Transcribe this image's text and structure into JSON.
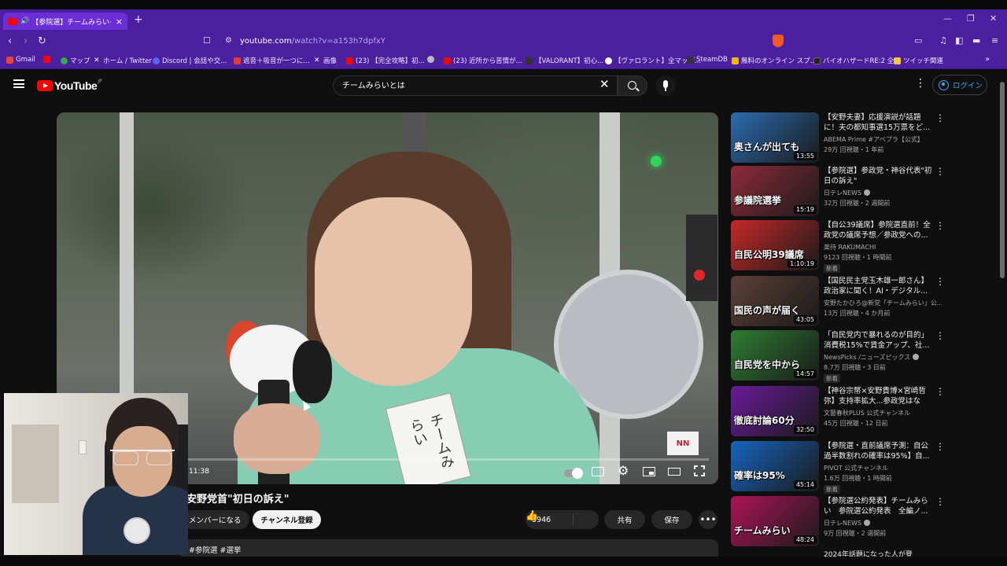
{
  "browser": {
    "tab_title": "【参院選】チームみらい· 安野党首",
    "new_tab": "+",
    "window_minimize": "—",
    "window_restore": "❐",
    "window_close": "✕",
    "url_host": "youtube.com",
    "url_path": "/watch?v=a153h7dpfxY",
    "brave_count": "99+"
  },
  "bookmarks": [
    {
      "label": "Gmail",
      "color": "#ea4335"
    },
    {
      "label": "",
      "color": "#ff0000"
    },
    {
      "label": "マップ",
      "color": "#34a853"
    },
    {
      "label": "ホーム / Twitter",
      "color": "#ffffff"
    },
    {
      "label": "Discord | 会話や交...",
      "color": "#5865f2"
    },
    {
      "label": "遮音＋吸音が一つに...",
      "color": "#e53935"
    },
    {
      "label": "画像",
      "color": "#ffffff"
    },
    {
      "label": "(23) 【完全攻略】初...",
      "color": "#ff0000"
    },
    {
      "label": "",
      "color": "#bbbbbb"
    },
    {
      "label": "(23) 近所から苦情が...",
      "color": "#ff0000"
    },
    {
      "label": "【VALORANT】初心...",
      "color": "#333333"
    },
    {
      "label": "【ヴァロラント】全マップ...",
      "color": "#ffffff"
    },
    {
      "label": "SteamDB",
      "color": "#333333"
    },
    {
      "label": "無料のオンライン スプ...",
      "color": "#f4b400"
    },
    {
      "label": "バイオハザードRE:2 全...",
      "color": "#222222"
    },
    {
      "label": "ツイッチ関連",
      "color": "#f4c542"
    }
  ],
  "youtube": {
    "logo_word": "YouTube",
    "region": "JP",
    "search_value": "チームみらいとは",
    "login_label": "ログイン"
  },
  "player": {
    "time": "11:38",
    "progress": 0.18,
    "name_tag": "チームみらい",
    "news_logo": "NN"
  },
  "video": {
    "title": "安野党首\"初日の訴え\"",
    "member_label": "メンバーになる",
    "subscribe_label": "チャンネル登録",
    "likes": "3946",
    "share_label": "共有",
    "save_label": "保存",
    "more": "•••",
    "hashtags": "#参院選 #選挙"
  },
  "recommendations": [
    {
      "title": "【安野夫妻】応援演説が話題に！夫の都知事選15万票をど...",
      "channel": "ABEMA Prime #アベプラ【公式】",
      "meta": "29万 回視聴・1 年前",
      "duration": "13:55",
      "thumb_text": "奥さんが出ても",
      "bg": "#2b6cb0",
      "verified": false,
      "is_new": false
    },
    {
      "title": "【参院選】参政党・神谷代表\"初日の訴え\"",
      "channel": "日テレNEWS",
      "meta": "32万 回視聴・2 週間前",
      "duration": "15:19",
      "thumb_text": "参議院選挙",
      "bg": "#8e2b3a",
      "verified": true,
      "is_new": false
    },
    {
      "title": "【自公39議席】参院選直前！全政党の議席予想／参政党への...",
      "channel": "楽待 RAKUMACHI",
      "meta": "9123 回視聴・1 時間前",
      "duration": "1:10:19",
      "thumb_text": "自民公明39議席",
      "bg": "#c62828",
      "verified": false,
      "is_new": true
    },
    {
      "title": "【国民民主党玉木雄一郎さん】政治家に聞く！AI・デジタル...",
      "channel": "安野たかひろ@新党「チームみらい」公...",
      "meta": "13万 回視聴・4 か月前",
      "duration": "43:05",
      "thumb_text": "国民の声が届く",
      "bg": "#5d4037",
      "verified": false,
      "is_new": false
    },
    {
      "title": "「自民党内で暴れるのが目的」消費税15%で賃金アップ、社...",
      "channel": "NewsPicks /ニューズピックス",
      "meta": "8.7万 回視聴・3 日前",
      "duration": "14:57",
      "thumb_text": "自民党を中から",
      "bg": "#2e7d32",
      "verified": true,
      "is_new": true
    },
    {
      "title": "【神谷宗幣×安野貴博×宮崎哲弥】支持率拡大...参政党はなぜ...",
      "channel": "文藝春秋PLUS 公式チャンネル",
      "meta": "45万 回視聴・12 日前",
      "duration": "32:50",
      "thumb_text": "徹底討論60分",
      "bg": "#6a1b9a",
      "verified": false,
      "is_new": false
    },
    {
      "title": "【参院選・直前議席予測：自公過半数割れの確率は95%】自...",
      "channel": "PIVOT 公式チャンネル",
      "meta": "1.6万 回視聴・1 時間前",
      "duration": "45:14",
      "thumb_text": "確率は95%",
      "bg": "#1565c0",
      "verified": false,
      "is_new": true
    },
    {
      "title": "【参院選公約発表】チームみらい　参院選公約発表　全編ノ...",
      "channel": "日テレNEWS",
      "meta": "9万 回視聴・2 週間前",
      "duration": "48:24",
      "thumb_text": "チームみらい",
      "bg": "#ad1457",
      "verified": true,
      "is_new": false
    }
  ],
  "new_badge_label": "新着",
  "peek_title": "2024年話題になった人が登"
}
